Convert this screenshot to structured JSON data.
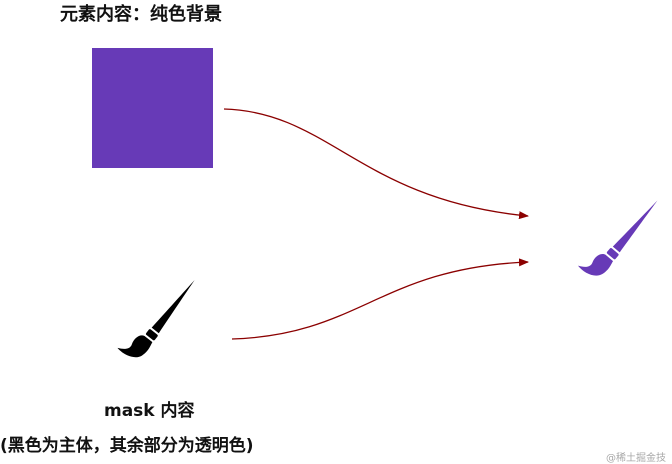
{
  "labels": {
    "element_content": "元素内容：纯色背景",
    "mask_content": "mask 内容",
    "mask_note": "(黑色为主体，其余部分为透明色)",
    "watermark": "@稀土掘金技"
  },
  "colors": {
    "element_fill": "#673ab7",
    "mask_fill": "#000000",
    "result_fill": "#673ab7",
    "arrow": "#8b0000"
  },
  "icons": {
    "mask_shape": "paint-brush-icon",
    "result_shape": "paint-brush-icon"
  }
}
